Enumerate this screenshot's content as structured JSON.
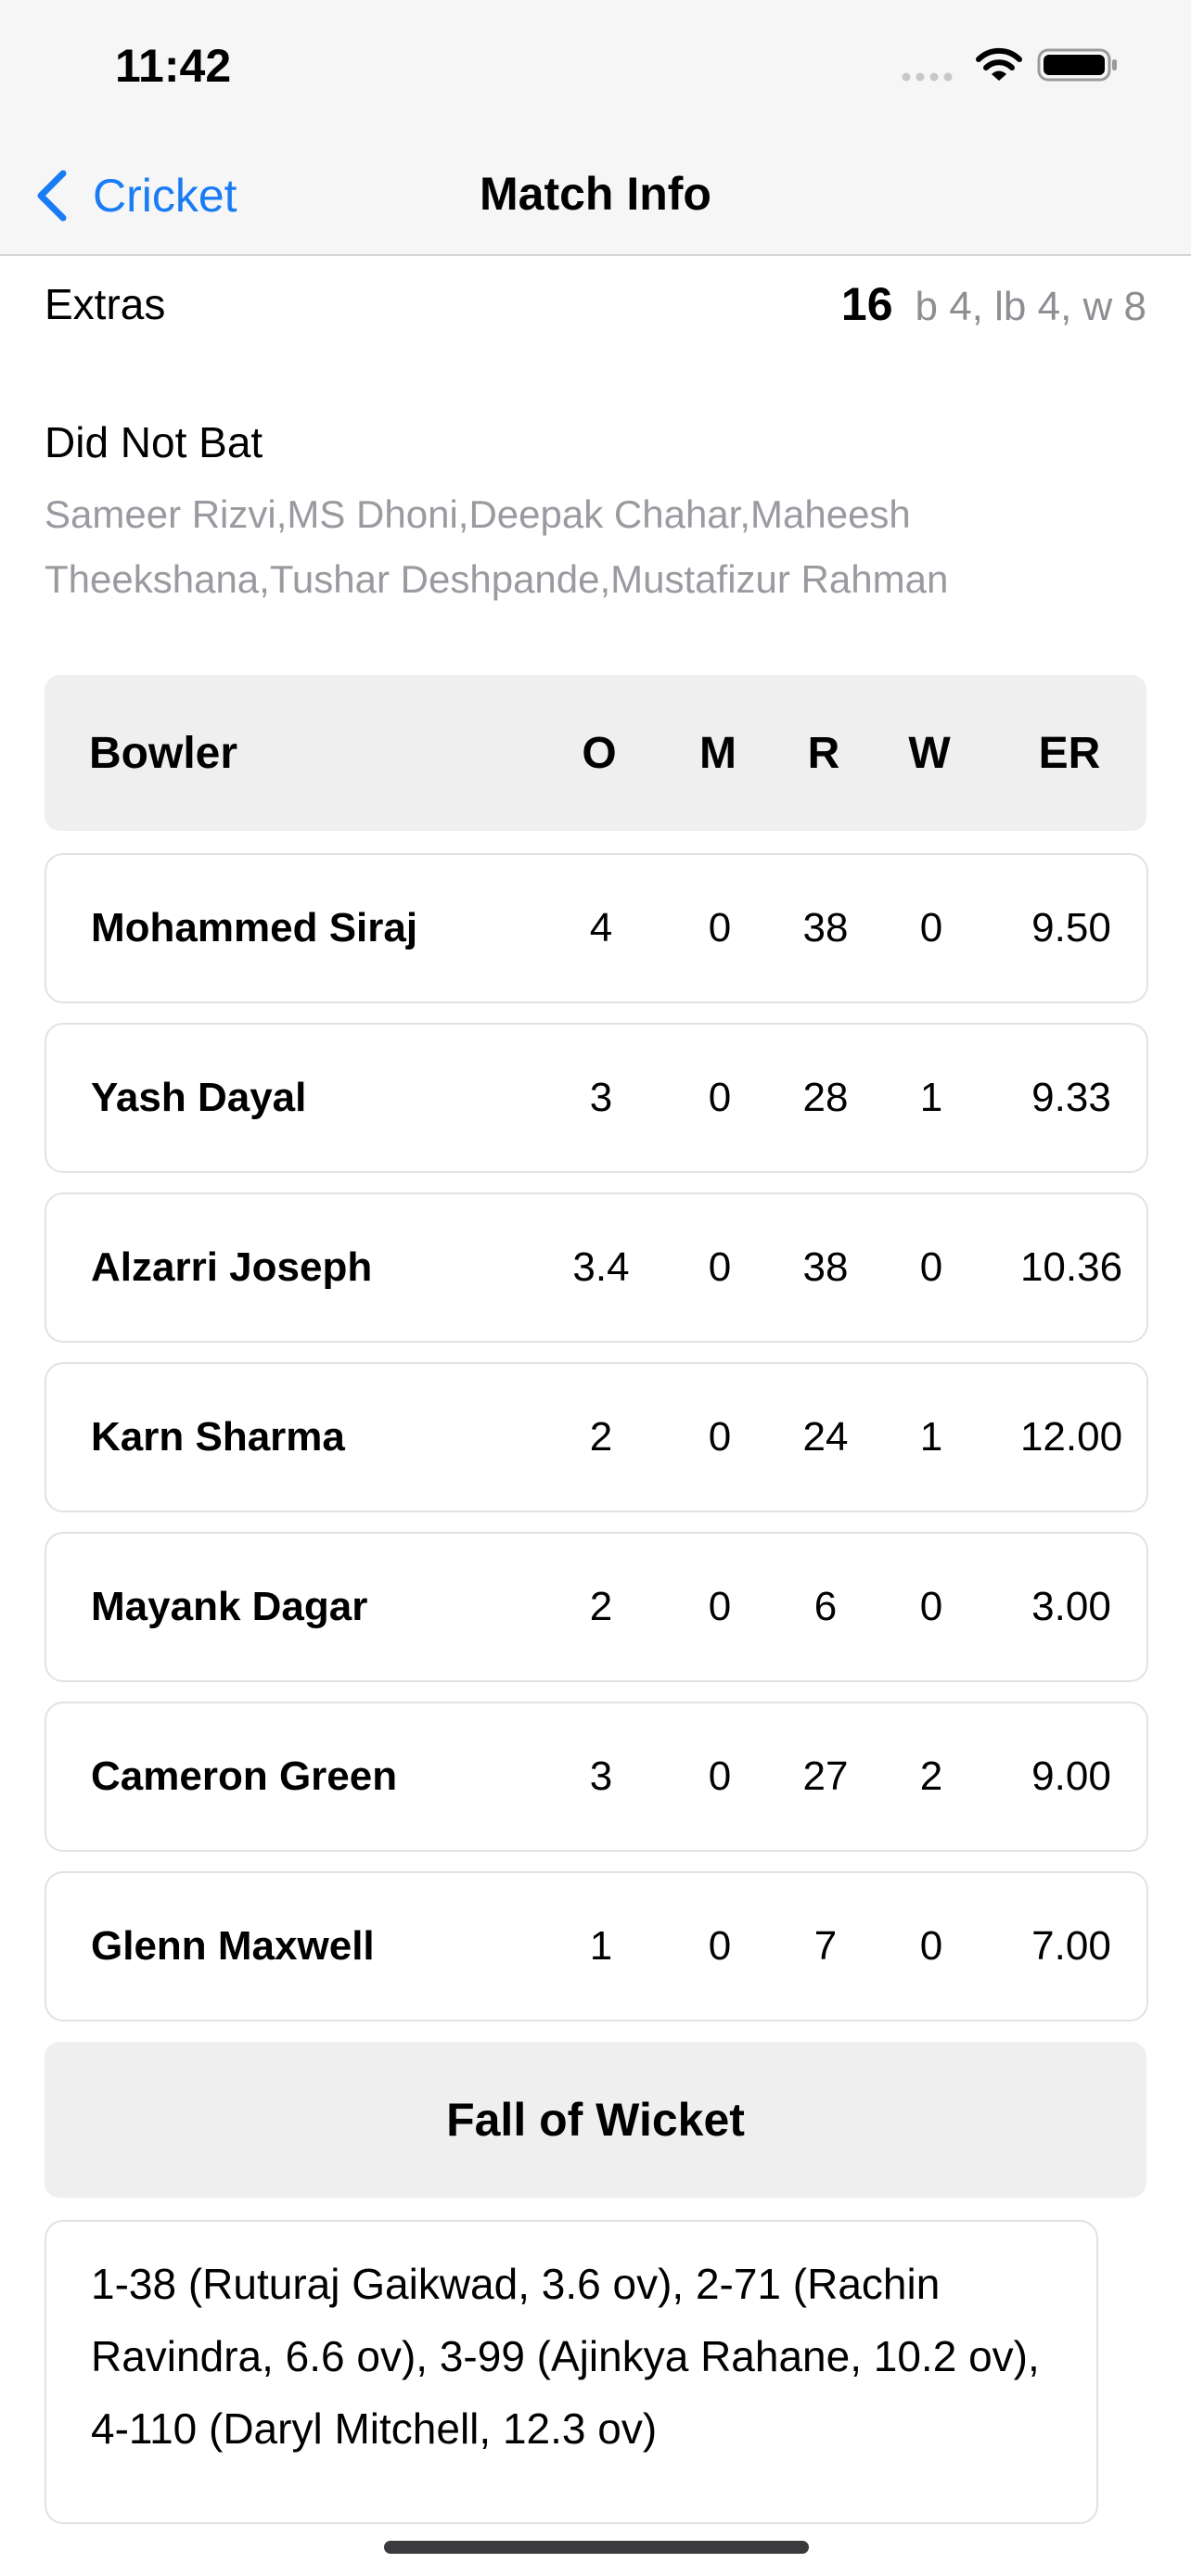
{
  "status": {
    "time": "11:42"
  },
  "nav": {
    "back_label": "Cricket",
    "title": "Match Info"
  },
  "extras": {
    "label": "Extras",
    "total": "16",
    "detail": "b 4, lb 4, w 8"
  },
  "did_not_bat": {
    "title": "Did Not Bat",
    "players": "Sameer Rizvi,MS Dhoni,Deepak Chahar,Maheesh Theekshana,Tushar Deshpande,Mustafizur Rahman"
  },
  "bowling": {
    "headers": {
      "bowler": "Bowler",
      "o": "O",
      "m": "M",
      "r": "R",
      "w": "W",
      "er": "ER"
    },
    "rows": [
      {
        "name": "Mohammed Siraj",
        "o": "4",
        "m": "0",
        "r": "38",
        "w": "0",
        "er": "9.50"
      },
      {
        "name": "Yash Dayal",
        "o": "3",
        "m": "0",
        "r": "28",
        "w": "1",
        "er": "9.33"
      },
      {
        "name": "Alzarri Joseph",
        "o": "3.4",
        "m": "0",
        "r": "38",
        "w": "0",
        "er": "10.36"
      },
      {
        "name": "Karn Sharma",
        "o": "2",
        "m": "0",
        "r": "24",
        "w": "1",
        "er": "12.00"
      },
      {
        "name": "Mayank Dagar",
        "o": "2",
        "m": "0",
        "r": "6",
        "w": "0",
        "er": "3.00"
      },
      {
        "name": "Cameron Green",
        "o": "3",
        "m": "0",
        "r": "27",
        "w": "2",
        "er": "9.00"
      },
      {
        "name": "Glenn Maxwell",
        "o": "1",
        "m": "0",
        "r": "7",
        "w": "0",
        "er": "7.00"
      }
    ]
  },
  "fall_of_wicket": {
    "title": "Fall of Wicket",
    "text": "1-38 (Ruturaj Gaikwad, 3.6 ov), 2-71 (Rachin Ravindra, 6.6 ov), 3-99 (Ajinkya Rahane, 10.2 ov), 4-110 (Daryl Mitchell, 12.3 ov)"
  },
  "colors": {
    "accent": "#1a7cf5",
    "secondary_text": "#8e8e93",
    "header_bg": "#efefef"
  }
}
